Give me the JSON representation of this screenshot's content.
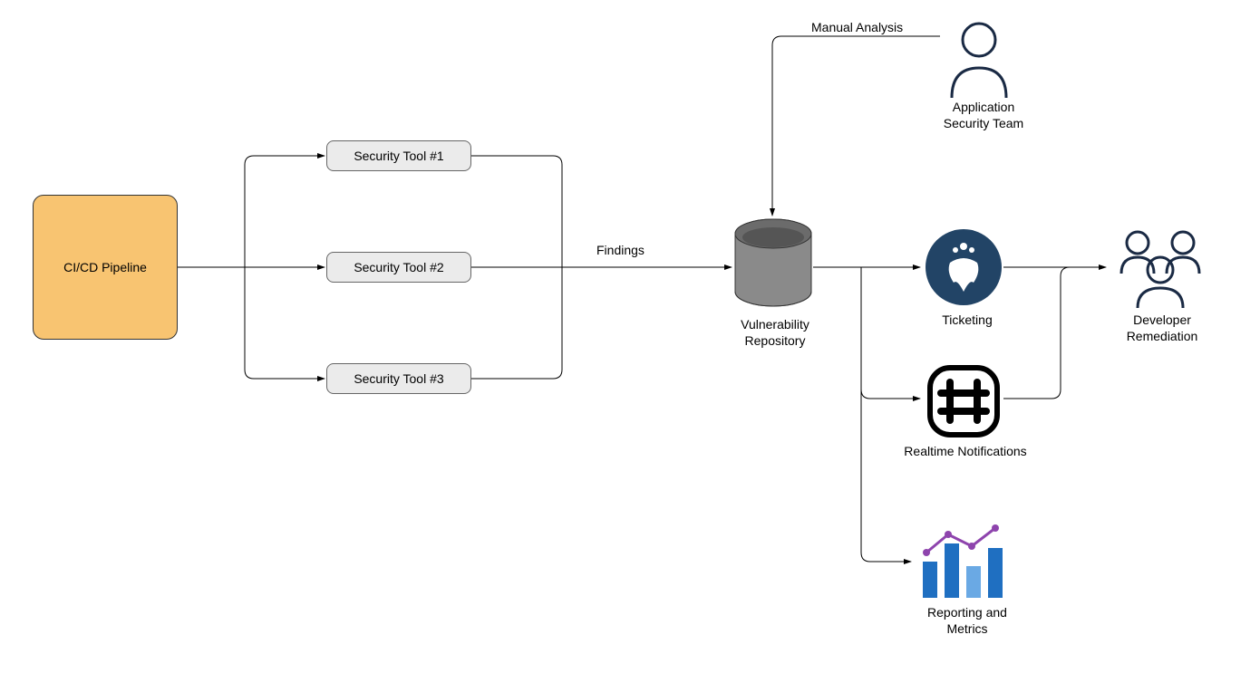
{
  "nodes": {
    "pipeline": {
      "label": "CI/CD Pipeline"
    },
    "tool1": {
      "label": "Security Tool #1"
    },
    "tool2": {
      "label": "Security Tool #2"
    },
    "tool3": {
      "label": "Security Tool #3"
    },
    "findings": {
      "label": "Findings"
    },
    "vuln_repo": {
      "label": "Vulnerability\nRepository"
    },
    "manual_analysis": {
      "label": "Manual Analysis"
    },
    "appsec_team": {
      "label": "Application\nSecurity Team"
    },
    "ticketing": {
      "label": "Ticketing"
    },
    "notifications": {
      "label": "Realtime Notifications"
    },
    "reporting": {
      "label": "Reporting and\nMetrics"
    },
    "developer": {
      "label": "Developer\nRemediation"
    }
  },
  "colors": {
    "pipeline_fill": "#f8c471",
    "tool_fill": "#ebebeb",
    "db_fill": "#6b6b6b",
    "ticketing_fill": "#1f3a5f",
    "bar_dark": "#1f6fc1",
    "bar_light": "#6aa9e4",
    "trend_line": "#8e44ad"
  }
}
